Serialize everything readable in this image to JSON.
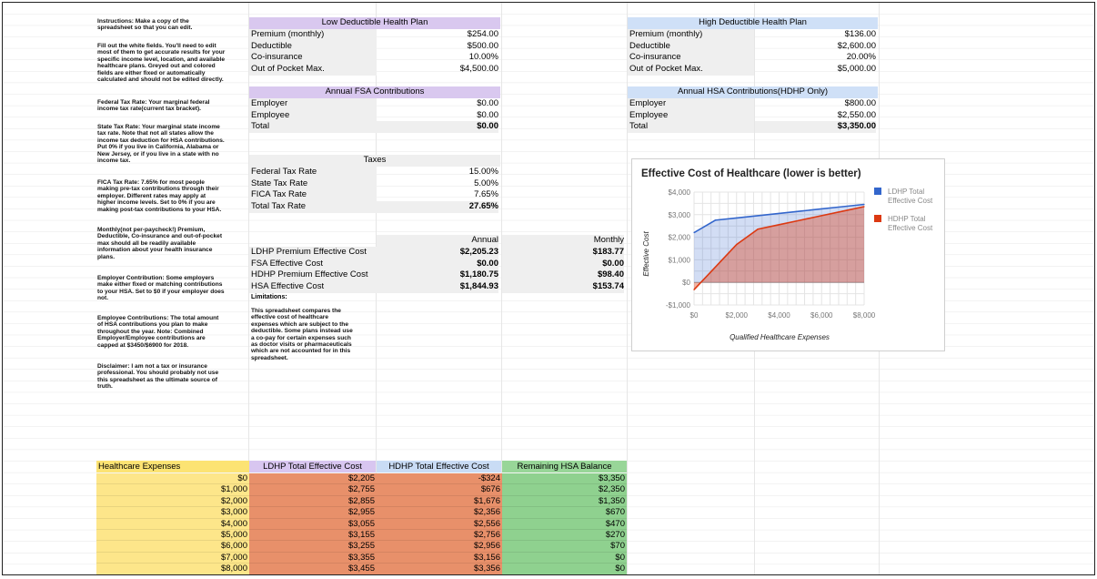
{
  "instructions": [
    "Instructions: Make a copy of the\nspreadsheet so that you can edit.",
    "Fill out the white fields. You'll need to edit\nmost of them to get accurate results for your\nspecific income level, location, and available\nhealthcare plans. Greyed out and colored\nfields are either fixed or automatically\ncalculated and should not be edited directly.",
    "Federal Tax Rate: Your marginal federal\nincome tax rate(current tax bracket).",
    "State Tax Rate: Your marginal state income\ntax rate. Note that not all states allow the\nincome tax deduction for HSA contributions.\nPut 0% if you live in California, Alabama or\nNew Jersey, or if you live in a state with no\nincome tax.",
    "FICA Tax Rate: 7.65% for most people\nmaking pre-tax contributions through their\nemployer. Different rates may apply at\nhigher income levels. Set to 0% if you are\nmaking post-tax contributions to your HSA.",
    "Monthly(not per-paycheck!) Premium,\nDeductible, Co-insurance and out-of-pocket\nmax should all be readily available\ninformation about your health insurance\nplans.",
    "Employer Contribution: Some employers\nmake either fixed or matching contributions\nto your HSA. Set to $0 if your employer does\nnot.",
    "Employee Contributions: The total amount\nof HSA contributions you plan to make\nthroughout the year. Note: Combined\nEmployer/Employee contributions are\ncapped at $3450/$6900 for 2018.",
    "Disclaimer: I am not a tax or insurance\nprofessional. You should probably not use\nthis spreadsheet as the ultimate source of\ntruth."
  ],
  "ldhp": {
    "title": "Low Deductible Health Plan",
    "rows": [
      {
        "label": "Premium (monthly)",
        "value": "$254.00"
      },
      {
        "label": "Deductible",
        "value": "$500.00"
      },
      {
        "label": "Co-insurance",
        "value": "10.00%"
      },
      {
        "label": "Out of Pocket Max.",
        "value": "$4,500.00"
      }
    ]
  },
  "hdhp": {
    "title": "High Deductible Health Plan",
    "rows": [
      {
        "label": "Premium (monthly)",
        "value": "$136.00"
      },
      {
        "label": "Deductible",
        "value": "$2,600.00"
      },
      {
        "label": "Co-insurance",
        "value": "20.00%"
      },
      {
        "label": "Out of Pocket Max.",
        "value": "$5,000.00"
      }
    ]
  },
  "fsa": {
    "title": "Annual FSA Contributions",
    "rows": [
      {
        "label": "Employer",
        "value": "$0.00"
      },
      {
        "label": "Employee",
        "value": "$0.00"
      },
      {
        "label": "Total",
        "value": "$0.00"
      }
    ]
  },
  "hsa": {
    "title": "Annual HSA Contributions(HDHP Only)",
    "rows": [
      {
        "label": "Employer",
        "value": "$800.00"
      },
      {
        "label": "Employee",
        "value": "$2,550.00"
      },
      {
        "label": "Total",
        "value": "$3,350.00"
      }
    ]
  },
  "taxes": {
    "title": "Taxes",
    "rows": [
      {
        "label": "Federal Tax Rate",
        "value": "15.00%"
      },
      {
        "label": "State Tax Rate",
        "value": "5.00%"
      },
      {
        "label": "FICA Tax Rate",
        "value": "7.65%"
      },
      {
        "label": "Total Tax Rate",
        "value": "27.65%"
      }
    ]
  },
  "effective": {
    "col_annual": "Annual",
    "col_monthly": "Monthly",
    "rows": [
      {
        "label": "LDHP Premium Effective Cost",
        "annual": "$2,205.23",
        "monthly": "$183.77"
      },
      {
        "label": "FSA Effective Cost",
        "annual": "$0.00",
        "monthly": "$0.00"
      },
      {
        "label": "HDHP Premium Effective Cost",
        "annual": "$1,180.75",
        "monthly": "$98.40"
      },
      {
        "label": "HSA Effective Cost",
        "annual": "$1,844.93",
        "monthly": "$153.74"
      }
    ],
    "limitations_label": "Limitations:",
    "limitations_text": "This spreadsheet compares the\neffective cost of healthcare\nexpenses which are subject to the\ndeductible. Some plans instead use\na co-pay for certain expenses such\nas doctor visits or pharmaceuticals\nwhich are not accounted for in this\nspreadsheet."
  },
  "bottom": {
    "headers": [
      "Healthcare Expenses",
      "LDHP Total Effective Cost",
      "HDHP Total Effective Cost",
      "Remaining HSA Balance"
    ],
    "rows": [
      [
        "$0",
        "$2,205",
        "-$324",
        "$3,350"
      ],
      [
        "$1,000",
        "$2,755",
        "$676",
        "$2,350"
      ],
      [
        "$2,000",
        "$2,855",
        "$1,676",
        "$1,350"
      ],
      [
        "$3,000",
        "$2,955",
        "$2,356",
        "$670"
      ],
      [
        "$4,000",
        "$3,055",
        "$2,556",
        "$470"
      ],
      [
        "$5,000",
        "$3,155",
        "$2,756",
        "$270"
      ],
      [
        "$6,000",
        "$3,255",
        "$2,956",
        "$70"
      ],
      [
        "$7,000",
        "$3,355",
        "$3,156",
        "$0"
      ],
      [
        "$8,000",
        "$3,455",
        "$3,356",
        "$0"
      ]
    ],
    "colors": {
      "yellow": "#fde68a",
      "red": "#e8906a",
      "green": "#8fd18f",
      "yellow_header": "#fce373",
      "purple_header": "#d8c6f0",
      "blue_header": "#c9dcf5",
      "green_header": "#98d698"
    }
  },
  "chart_data": {
    "type": "area",
    "title": "Effective Cost of Healthcare (lower is better)",
    "xlabel": "Qualified Healthcare Expenses",
    "ylabel": "Effective Cost",
    "x_ticks": [
      "$0",
      "$2,000",
      "$4,000",
      "$6,000",
      "$8,000"
    ],
    "y_ticks": [
      "$4,000",
      "$3,000",
      "$2,000",
      "$1,000",
      "$0",
      "-$1,000"
    ],
    "xlim": [
      0,
      8000
    ],
    "ylim": [
      -1000,
      4000
    ],
    "x": [
      0,
      1000,
      2000,
      3000,
      4000,
      5000,
      6000,
      7000,
      8000
    ],
    "series": [
      {
        "name": "LDHP Total Effective Cost",
        "color": "#3366cc",
        "values": [
          2205,
          2755,
          2855,
          2955,
          3055,
          3155,
          3255,
          3355,
          3455
        ]
      },
      {
        "name": "HDHP Total Effective Cost",
        "color": "#dc3912",
        "values": [
          -324,
          676,
          1676,
          2356,
          2556,
          2756,
          2956,
          3156,
          3356
        ]
      }
    ],
    "legend": "right",
    "grid": true
  }
}
